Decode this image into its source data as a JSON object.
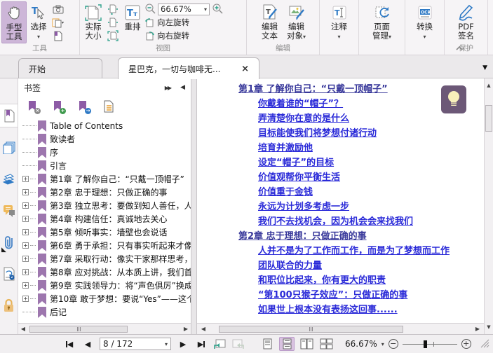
{
  "ribbon": {
    "group_tools": "工具",
    "group_view": "视图",
    "group_edit": "编辑",
    "group_protect": "保护",
    "hand_tool": "手型工具",
    "select": "选择",
    "actual_size": "实际大小",
    "reflow": "重排",
    "zoom_value": "66.67%",
    "rotate_left": "向左旋转",
    "rotate_right": "向右旋转",
    "edit_text": "编辑文本",
    "edit_object": "编辑对象",
    "comment": "注释",
    "page_manage": "页面管理",
    "convert": "转换",
    "pdf_sign": "PDF签名"
  },
  "tabs": {
    "start": "开始",
    "document": "星巴克，一切与咖啡无...",
    "close": "×"
  },
  "icons": {
    "chevron_down": "▾",
    "double_right": "▶▶",
    "collapse_left": "◀",
    "left": "◀",
    "right": "▶",
    "up": "▲",
    "down": "▼",
    "minus": "−",
    "plus": "+",
    "plus_box": "+",
    "corner_triangle": "◣",
    "lightbulb": "lightbulb-note-annotation"
  },
  "bookmarks": {
    "title": "书签",
    "items": [
      {
        "label": "Table of Contents"
      },
      {
        "label": "致读者"
      },
      {
        "label": "序"
      },
      {
        "label": "引言"
      },
      {
        "label": "第1章 了解你自己：“只戴一顶帽子”"
      },
      {
        "label": "第2章 忠于理想：只做正确的事"
      },
      {
        "label": "第3章 独立思考：要做到知人善任，人"
      },
      {
        "label": "第4章 构建信任：真诚地去关心"
      },
      {
        "label": "第5章 倾听事实：墙壁也会说话"
      },
      {
        "label": "第6章 勇于承担：只有事实听起来才像"
      },
      {
        "label": "第7章 采取行动：像实干家那样思考，"
      },
      {
        "label": "第8章 应对挑战：从本质上讲，我们首"
      },
      {
        "label": "第9章 实践领导力：将“声色俱厉”换成"
      },
      {
        "label": "第10章 敢于梦想：要说“Yes”——这个"
      },
      {
        "label": "后记"
      }
    ]
  },
  "document_toc": [
    {
      "level": 1,
      "text": "第1章 了解你自己：“只戴一顶帽子”"
    },
    {
      "level": 2,
      "text": "你戴着谁的“帽子”？"
    },
    {
      "level": 2,
      "text": "弄清楚你在意的是什么"
    },
    {
      "level": 2,
      "text": "目标能使我们将梦想付诸行动"
    },
    {
      "level": 2,
      "text": "培育并激励他"
    },
    {
      "level": 2,
      "text": "设定“帽子”的目标"
    },
    {
      "level": 2,
      "text": "价值观帮你平衡生活"
    },
    {
      "level": 2,
      "text": "价值重于金钱"
    },
    {
      "level": 2,
      "text": "永远为计划多考虑一步"
    },
    {
      "level": 2,
      "text": "我们不去找机会，因为机会会来找我们"
    },
    {
      "level": 1,
      "text": "第2章 忠于理想：只做正确的事"
    },
    {
      "level": 2,
      "text": "人并不是为了工作而工作，而是为了梦想而工作"
    },
    {
      "level": 2,
      "text": "团队联合的力量"
    },
    {
      "level": 2,
      "text": "和职位比起来，你有更大的职责"
    },
    {
      "level": 2,
      "text": "“第100只猴子效应”：只做正确的事"
    },
    {
      "level": 2,
      "text": "如果世上根本没有表扬这回事......"
    }
  ],
  "status_bar": {
    "page_field": "8 / 172",
    "zoom_value": "66.67%"
  },
  "colors": {
    "active_tool_bg": "#cdb6d8",
    "bookmark_purple": "#9d76ae",
    "link_blue": "#2a2ad8",
    "chapter_blue": "#39399b",
    "icon_teal": "#2fa28c",
    "icon_blue": "#2f7ac5",
    "icon_orange": "#e8a33d",
    "annotation_bg": "#6c5877",
    "annotation_bulb": "#f8f0bb"
  }
}
